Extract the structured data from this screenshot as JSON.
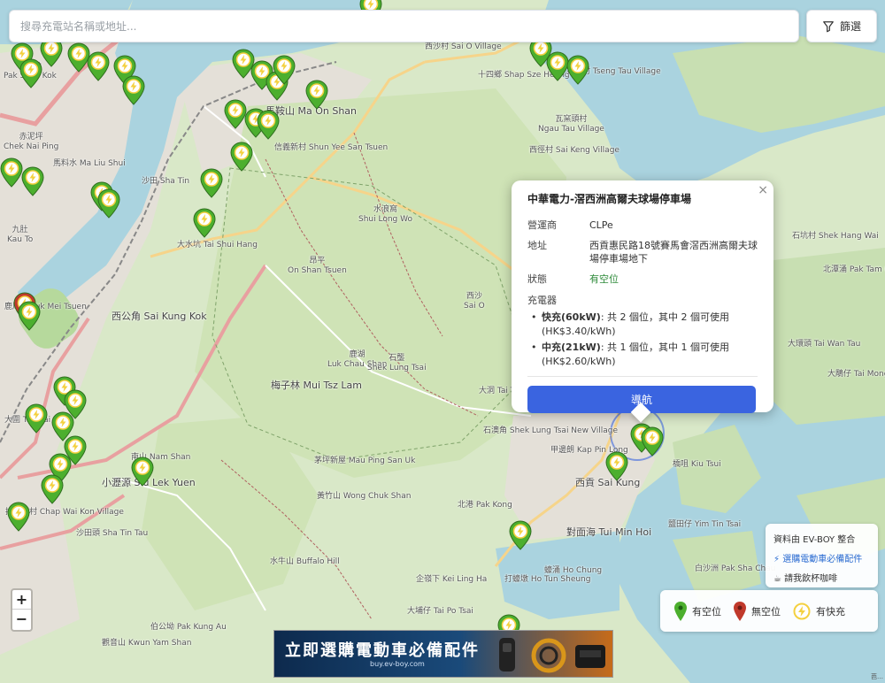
{
  "search": {
    "placeholder": "搜尋充電站名稱或地址..."
  },
  "filter": {
    "label": "篩選",
    "icon": "filter-icon"
  },
  "colors": {
    "available": "#4caf2e",
    "unavailable": "#c0392b",
    "fast": "#f4d03f",
    "nav_button": "#3a64e0",
    "link": "#2a6bd1"
  },
  "popup": {
    "title": "中華電力-滘西洲高爾夫球場停車場",
    "operator_label": "營運商",
    "operator": "CLPe",
    "address_label": "地址",
    "address": "西貢惠民路18號賽馬會滘西洲高爾夫球場停車場地下",
    "status_label": "狀態",
    "status": "有空位",
    "chargers_label": "充電器",
    "chargers": [
      {
        "type": "快充(60kW)",
        "detail": ": 共 2 個位，其中 2 個可使用 (HK$3.40/kWh)"
      },
      {
        "type": "中充(21kW)",
        "detail": ": 共 1 個位，其中 1 個可使用 (HK$2.60/kWh)"
      }
    ],
    "nav_label": "導航",
    "close": "×"
  },
  "zoom": {
    "in": "+",
    "out": "−"
  },
  "info": {
    "credit": "資料由 EV-BOY 整合",
    "accessories": "⚡ 選購電動車必備配件",
    "coffee": "☕ 請我飲杯咖啡"
  },
  "legend": {
    "available": "有空位",
    "unavailable": "無空位",
    "fast": "有快充"
  },
  "banner": {
    "title": "立即選購電動車必備配件",
    "url": "buy.ev-boy.com"
  },
  "places": [
    {
      "text": "白石角\nPak Shek Kok"
    },
    {
      "text": "赤泥坪\nChek Nai Ping"
    },
    {
      "text": "馬料水 Ma Liu Shui"
    },
    {
      "text": "九肚\nKau To"
    },
    {
      "text": "大水坑 Tai Shui Hang"
    },
    {
      "text": "西沙村 Sai O Village"
    },
    {
      "text": "十四鄉 Shap Sze Heung"
    },
    {
      "text": "井頭村 Tseng Tau Village"
    },
    {
      "text": "瓦窯頭村\nNgau Tau Village"
    },
    {
      "text": "西徑村 Sai Keng Village"
    },
    {
      "text": "信義新村 Shun Yee San Tsuen"
    },
    {
      "text": "昂平\nOn Shan Tsuen"
    },
    {
      "text": "水浪窩\nShui Long Wo"
    },
    {
      "text": "鹿湖\nLuk Chau Shan"
    },
    {
      "text": "石壟\nShek Lung Tsai"
    },
    {
      "text": "梅子林 Mui Tsz Lam"
    },
    {
      "text": "西沙\nSai O"
    },
    {
      "text": "大洞 Tai Tung"
    },
    {
      "text": "石澳角 Shek Lung Tsai New Village"
    },
    {
      "text": "甲邊朗 Kap Pin Long"
    },
    {
      "text": "西貢 Sai Kung"
    },
    {
      "text": "茅坪新屋 Mau Ping San Uk"
    },
    {
      "text": "黃竹山 Wong Chuk Shan"
    },
    {
      "text": "北港 Pak Kong"
    },
    {
      "text": "對面海 Tui Min Hoi"
    },
    {
      "text": "蠔涌 Ho Chung"
    },
    {
      "text": "南山 Nam Shan"
    },
    {
      "text": "小瀝源 Siu Lek Yuen"
    },
    {
      "text": "插桅杆村 Chap Wai Kon Village"
    },
    {
      "text": "沙田頭 Sha Tin Tau"
    },
    {
      "text": "水牛山 Buffalo Hill"
    },
    {
      "text": "企嶺下 Kei Ling Ha"
    },
    {
      "text": "打蠔墩 Ho Tun Sheung"
    },
    {
      "text": "伯公坳 Pak Kung Au"
    },
    {
      "text": "觀音山 Kwun Yam Shan"
    },
    {
      "text": "大埔仔 Tai Po Tsai"
    },
    {
      "text": "白沙洲 Pak Sha Chau"
    },
    {
      "text": "鹽田仔 Yim Tin Tsai"
    },
    {
      "text": "橋咀 Kiu Tsui"
    },
    {
      "text": "大鵰仔 Tai Mong Tsai"
    },
    {
      "text": "石坑村 Shek Hang Wai"
    },
    {
      "text": "北潭涌 Pak Tam Chung"
    },
    {
      "text": "大環頭 Tai Wan Tau"
    },
    {
      "text": "馬鞍山 Ma On Shan"
    },
    {
      "text": "沙田 Sha Tin"
    },
    {
      "text": "大圍 Tai Wai"
    },
    {
      "text": "西公角 Sai Kung Kok"
    },
    {
      "text": "鹿尾村 Luk Mei Tsuen"
    }
  ],
  "osm_credit": "芭…"
}
